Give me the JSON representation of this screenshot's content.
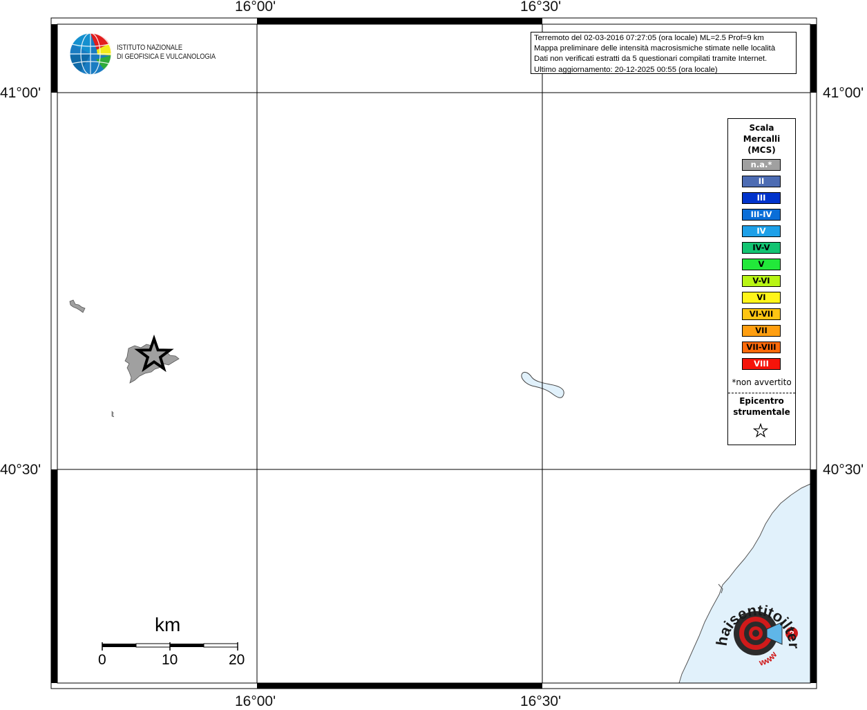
{
  "header": {
    "institute_line1": "ISTITUTO NAZIONALE",
    "institute_line2": "DI GEOFISICA E VULCANOLOGIA"
  },
  "info": {
    "line1": "Terremoto del 02-03-2016 07:27:05 (ora locale) ML=2.5 Prof=9 km",
    "line2": "Mappa preliminare delle intensità macrosismiche stimate nelle località",
    "line3": "Dati non verificati estratti da 5 questionari compilati tramite Internet.",
    "line4": "Ultimo aggiornamento: 20-12-2025 00:55 (ora locale)"
  },
  "axes": {
    "lon_ticks": [
      "16°00'",
      "16°30'"
    ],
    "lat_ticks": [
      "41°00'",
      "40°30'"
    ]
  },
  "legend": {
    "title": "Scala\nMercalli\n(MCS)",
    "items": [
      {
        "label": "n.a.*",
        "color": "#a0a0a0",
        "text_color": "#ffffff"
      },
      {
        "label": "II",
        "color": "#4d6cb3",
        "text_color": "#ffffff"
      },
      {
        "label": "III",
        "color": "#0033cc",
        "text_color": "#ffffff"
      },
      {
        "label": "III-IV",
        "color": "#0a6ed8",
        "text_color": "#ffffff"
      },
      {
        "label": "IV",
        "color": "#1ea0e8",
        "text_color": "#ffffff"
      },
      {
        "label": "IV-V",
        "color": "#13c472",
        "text_color": "#000000"
      },
      {
        "label": "V",
        "color": "#22e83a",
        "text_color": "#000000"
      },
      {
        "label": "V-VI",
        "color": "#b8f514",
        "text_color": "#000000"
      },
      {
        "label": "VI",
        "color": "#fff51a",
        "text_color": "#000000"
      },
      {
        "label": "VI-VII",
        "color": "#ffc512",
        "text_color": "#000000"
      },
      {
        "label": "VII",
        "color": "#ff9e10",
        "text_color": "#000000"
      },
      {
        "label": "VII-VIII",
        "color": "#ff6a0a",
        "text_color": "#000000"
      },
      {
        "label": "VIII",
        "color": "#f5140a",
        "text_color": "#ffffff"
      }
    ],
    "note": "*non avvertito",
    "epicenter_label": "Epicentro\nstrumentale"
  },
  "scale_bar": {
    "unit": "km",
    "labels": [
      "0",
      "10",
      "20"
    ]
  },
  "watermark": {
    "text": "haisentitoilterremoto.it",
    "prefix": "www."
  },
  "colors": {
    "sea": "#e1f1fb",
    "felt_area": "#a0a0a0",
    "frame": "#000000"
  }
}
